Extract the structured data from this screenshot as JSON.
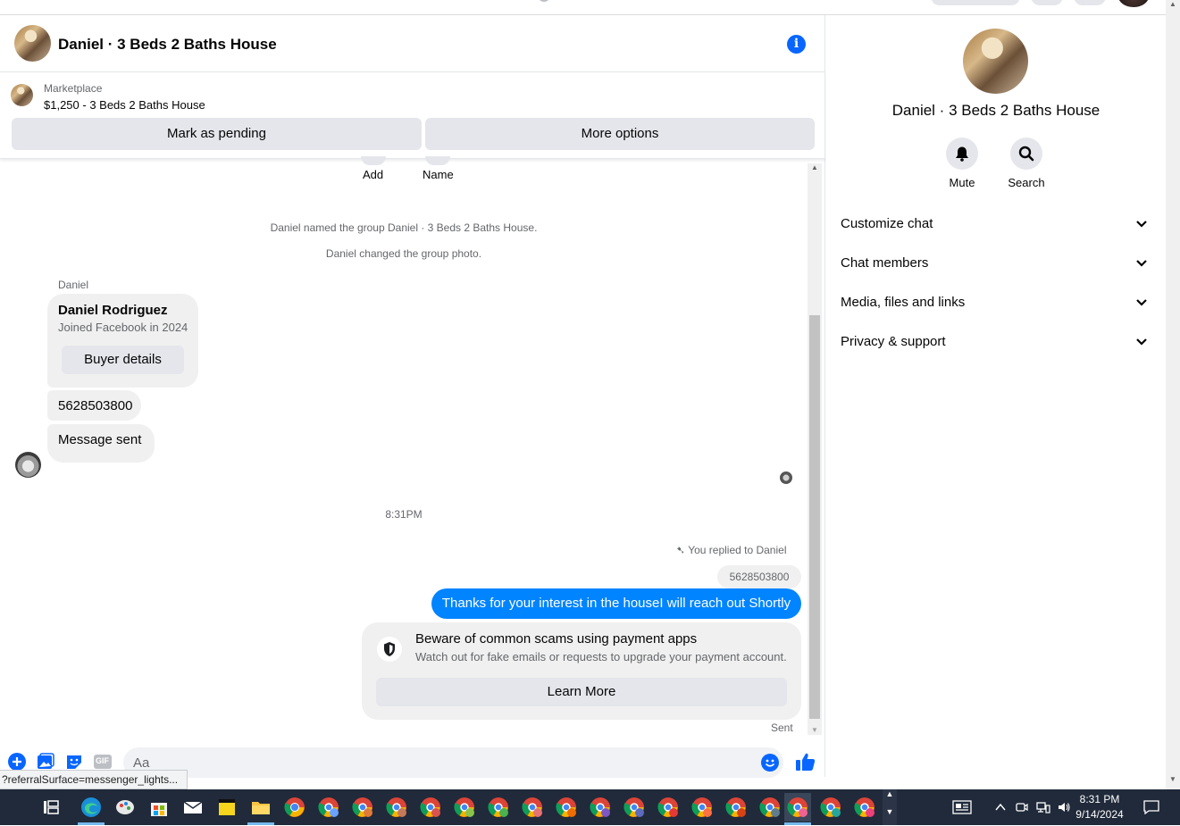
{
  "chat": {
    "title": "Daniel · 3 Beds 2 Baths House",
    "marketplace_label": "Marketplace",
    "listing": "$1,250 - 3 Beds 2 Baths House",
    "mark_pending_label": "Mark as pending",
    "more_options_label": "More options",
    "add_label": "Add",
    "name_label": "Name",
    "system_messages": [
      "Daniel named the group Daniel · 3 Beds 2 Baths House.",
      "Daniel changed the group photo."
    ],
    "sender_name": "Daniel",
    "profile_card": {
      "name": "Daniel Rodriguez",
      "subtitle": "Joined Facebook in 2024",
      "button_label": "Buyer details"
    },
    "incoming_messages": [
      "5628503800",
      "Message sent"
    ],
    "timestamp": "8:31PM",
    "replied_label": "You replied to Daniel",
    "quoted_text": "5628503800",
    "outgoing_message": "Thanks for your interest in the houseI will reach out Shortly",
    "scam_notice": {
      "title": "Beware of common scams using payment apps",
      "subtitle": "Watch out for fake emails or requests to upgrade your payment account.",
      "button_label": "Learn More"
    },
    "sent_status": "Sent",
    "composer_placeholder": "Aa",
    "gif_label": "GIF"
  },
  "status_url": "?referralSurface=messenger_lights...",
  "sidebar": {
    "title": "Daniel · 3 Beds 2 Baths House",
    "actions": [
      {
        "label": "Mute",
        "icon": "bell-icon"
      },
      {
        "label": "Search",
        "icon": "search-icon"
      }
    ],
    "sections": [
      {
        "label": "Customize chat"
      },
      {
        "label": "Chat members"
      },
      {
        "label": "Media, files and links"
      },
      {
        "label": "Privacy & support"
      }
    ]
  },
  "taskbar": {
    "time": "8:31 PM",
    "date": "9/14/2024"
  },
  "colors": {
    "accent": "#0866ff",
    "outgoing_bubble": "#0084ff",
    "bubble_gray": "#f0f0f0",
    "taskbar": "#202a3a"
  }
}
